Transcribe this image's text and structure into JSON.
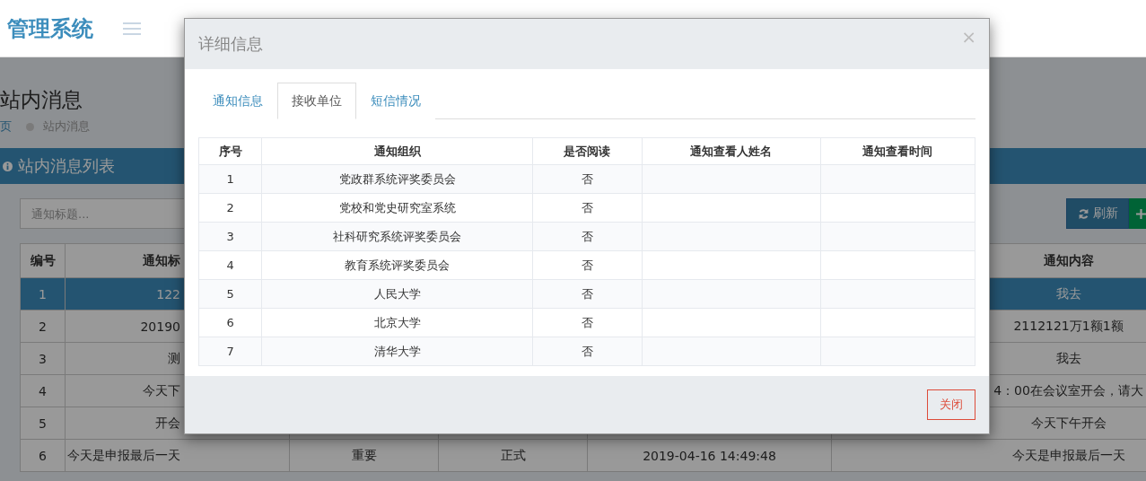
{
  "header": {
    "logo": "管理系统"
  },
  "page": {
    "title": "站内消息",
    "breadcrumb": [
      "页",
      "站内消息"
    ]
  },
  "panel": {
    "title": "站内消息列表",
    "search": {
      "placeholder": "通知标题..."
    },
    "refresh_button": "刷新"
  },
  "table": {
    "columns": [
      "编号",
      "通知标",
      "通知内容"
    ],
    "rows": [
      {
        "no": "1",
        "title": "122",
        "content": "我去",
        "selected": true
      },
      {
        "no": "2",
        "title": "20190",
        "content": "2112121万1额1额",
        "selected": false
      },
      {
        "no": "3",
        "title": "测",
        "content": "我去",
        "selected": false
      },
      {
        "no": "4",
        "title": "今天下",
        "content": "4：00在会议室开会，请大",
        "selected": false
      },
      {
        "no": "5",
        "title": "开会",
        "content": "今天下午开会",
        "selected": false
      },
      {
        "no": "6",
        "title": "今天是申报最后一天",
        "column_3": "重要",
        "column_4": "正式",
        "time": "2019-04-16 14:49:48",
        "content": "今天是申报最后一天",
        "selected": false
      }
    ]
  },
  "dialog": {
    "title": "详细信息",
    "close": "×",
    "tabs": [
      {
        "label": "通知信息",
        "selected": false
      },
      {
        "label": "接收单位",
        "selected": true
      },
      {
        "label": "短信情况",
        "selected": false
      }
    ],
    "table": {
      "columns": [
        "序号",
        "通知组织",
        "是否阅读",
        "通知查看人姓名",
        "通知查看时间"
      ],
      "rows": [
        [
          "1",
          "党政群系统评奖委员会",
          "否"
        ],
        [
          "2",
          "党校和党史研究室系统",
          "否"
        ],
        [
          "3",
          "社科研究系统评奖委员会",
          "否"
        ],
        [
          "4",
          "教育系统评奖委员会",
          "否"
        ],
        [
          "5",
          "人民大学",
          "否"
        ],
        [
          "6",
          "北京大学",
          "否"
        ],
        [
          "7",
          "清华大学",
          "否"
        ]
      ]
    },
    "footer_button": "关闭"
  }
}
